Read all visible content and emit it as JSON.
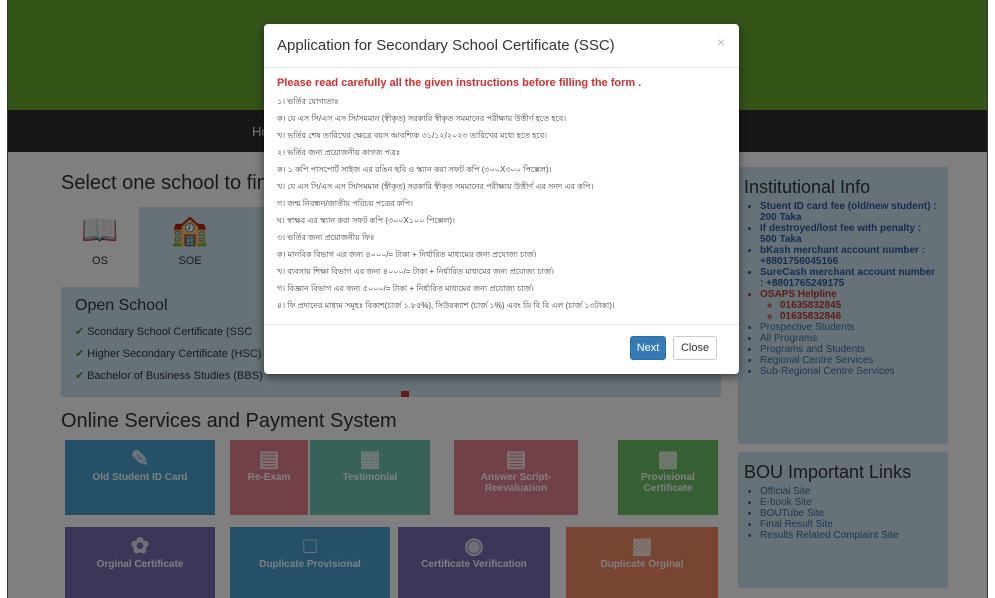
{
  "navbar": {
    "home": "Ho"
  },
  "main": {
    "select_heading": "Select one school to find",
    "tiles": [
      {
        "label": "OS",
        "icon": "book-icon"
      },
      {
        "label": "SOE",
        "icon": "school-icon"
      }
    ],
    "open_school": "Open School",
    "programs": [
      "Scondary School Certificate (SSC",
      "Higher Secondary Certificate (HSC)",
      "Bachelor of Business Studies (BBS)"
    ],
    "online_heading": "Online Services and Payment System",
    "services": [
      {
        "label": "Old Student ID Card",
        "color": "#4aa0cf"
      },
      {
        "label": "Re-Exam",
        "color": "#e3828e"
      },
      {
        "label": "Testimonial",
        "color": "#6dc5b3"
      },
      {
        "label": "Answer Script-Reevaluation",
        "color": "#e3828e"
      },
      {
        "label": "Provisional Certificate",
        "color": "#6dbf66"
      },
      {
        "label": "Orginal Certificate",
        "color": "#7a6cb0"
      },
      {
        "label": "Duplicate Provisional",
        "color": "#4aa0cf"
      },
      {
        "label": "Certificate Verification",
        "color": "#7a6cb0"
      },
      {
        "label": "Duplicate Orginal",
        "color": "#f08a64"
      }
    ]
  },
  "institutional": {
    "title": "Institutional Info",
    "items": [
      "Stuent ID card fee (old/new student) : 200 Taka",
      "If destroyed/lost fee with penalty : 500 Taka",
      "bKash merchant account number : +8801756045166",
      "SureCash merchant account number : +8801765249175",
      "OSAPS Helpline"
    ],
    "helplines": [
      "01635832845",
      "01635832846"
    ],
    "links": [
      "Prospective Students",
      "All Programs",
      "Programs and Students",
      "Regional Centre Services",
      "Sub-Regional Centre Services"
    ]
  },
  "important": {
    "title": "BOU Important Links",
    "links": [
      "Official Site",
      "E-book Site",
      "BOUTube Site",
      "Final Result Site",
      "Results Related Complaint Site"
    ]
  },
  "modal": {
    "title": "Application for Secondary School Certificate (SSC)",
    "close_x": "×",
    "warning": "Please read carefully all the given instructions before filling the form .",
    "instructions": [
      "১। ভর্তির যোগ্যতাঃ",
      "ক। যে এস সি/এস এস সি/সমমান (স্বীকৃত) সরকারি স্বীকৃত সমমানের পরীক্ষায় উত্তীর্ণ হতে হবে।",
      "খ। ভর্তির শেষ তারিখের ক্ষেত্রে বয়স আবশ্যিক ৩১/১২/২০২৩ তারিখের মধ্যে হতে হবে।",
      "২। ভর্তির জন্য প্রয়োজনীয় কাগজ পত্রঃ",
      "ক। ১ কপি পাসপোর্ট সাইজ এর রঙিন ছবি ও স্ক্যান করা সফট কপি (৩০০X৩০০ পিক্সেল)।",
      "খ। যে এস সি/এস এস সি/সমমান (স্বীকৃত) সরকারি স্বীকৃত সমমানের পরীক্ষায় উত্তীর্ণ এর সনদ এর কপি।",
      "গ। জন্ম নিবন্ধন/জাতীয় পরিচয় পত্রের কপি।",
      "ঘ। স্বাক্ষর এর স্ক্যান করা সফট কপি (৩০০X১০০ পিক্সেল)।",
      "৩। ভর্তির জন্য প্রয়োজনীয় ফিঃ",
      "ক। মানবিক বিভাগ এর জন্য ৪০০০/= টাকা + নির্ধারিত মাধ্যমের জন্য প্রযোজ্য চার্জ।",
      "খ। ব্যবসায় শিক্ষা বিভাগ এর জন্য ৪০০০/= টাকা + নির্ধারিত মাধ্যমের জন্য প্রযোজ্য চার্জ।",
      "গ। বিজ্ঞান বিভাগ এর জন্য ৫০০০/= টাকা + নির্ধারিত মাধ্যমের জন্য প্রযোজ্য চার্জ।",
      "৪। ফি প্রদানের মাধ্যম সমূহঃ বিকাশ(চার্জ ১.৮৫%), সিউরক্যাশ (চার্জ ১%) এবং ডি বি বি এল (চার্জ ১৩টাকা)।"
    ],
    "next_label": "Next",
    "close_label": "Close"
  },
  "colors": {
    "header_green": "#6aa830",
    "primary": "#337ab7",
    "warning_red": "#d32f2f"
  }
}
